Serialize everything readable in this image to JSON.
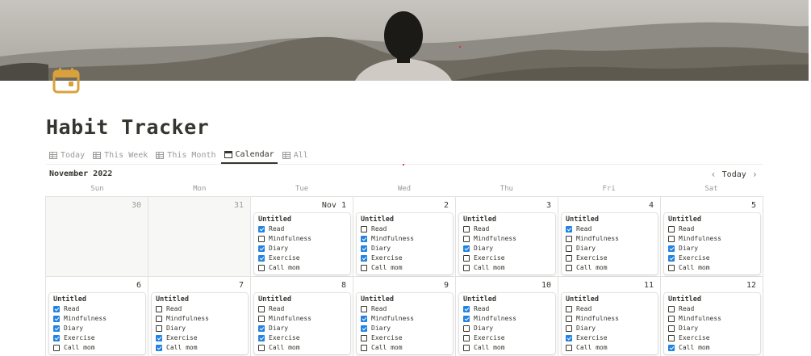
{
  "page": {
    "title": "Habit Tracker",
    "icon": "calendar-icon"
  },
  "tabs": [
    {
      "label": "Today",
      "icon": "table-icon",
      "active": false
    },
    {
      "label": "This Week",
      "icon": "table-icon",
      "active": false
    },
    {
      "label": "This Month",
      "icon": "table-icon",
      "active": false
    },
    {
      "label": "Calendar",
      "icon": "calendar-icon",
      "active": true
    },
    {
      "label": "All",
      "icon": "table-icon",
      "active": false
    }
  ],
  "calendar": {
    "month": "November 2022",
    "today_label": "Today",
    "weekdays": [
      "Sun",
      "Mon",
      "Tue",
      "Wed",
      "Thu",
      "Fri",
      "Sat"
    ],
    "days": [
      {
        "label": "30",
        "outside": true,
        "card": null
      },
      {
        "label": "31",
        "outside": true,
        "card": null
      },
      {
        "label": "Nov 1",
        "outside": false,
        "card": {
          "title": "Untitled",
          "checks": [
            true,
            false,
            true,
            true,
            false
          ]
        }
      },
      {
        "label": "2",
        "outside": false,
        "card": {
          "title": "Untitled",
          "checks": [
            false,
            true,
            true,
            true,
            false
          ]
        }
      },
      {
        "label": "3",
        "outside": false,
        "card": {
          "title": "Untitled",
          "checks": [
            false,
            false,
            true,
            false,
            false
          ]
        }
      },
      {
        "label": "4",
        "outside": false,
        "card": {
          "title": "Untitled",
          "checks": [
            true,
            false,
            false,
            false,
            false
          ]
        }
      },
      {
        "label": "5",
        "outside": false,
        "card": {
          "title": "Untitled",
          "checks": [
            false,
            false,
            true,
            true,
            false
          ]
        }
      },
      {
        "label": "6",
        "outside": false,
        "card": {
          "title": "Untitled",
          "checks": [
            true,
            true,
            true,
            true,
            false
          ]
        }
      },
      {
        "label": "7",
        "outside": false,
        "card": {
          "title": "Untitled",
          "checks": [
            false,
            false,
            false,
            true,
            true
          ]
        }
      },
      {
        "label": "8",
        "outside": false,
        "card": {
          "title": "Untitled",
          "checks": [
            false,
            false,
            true,
            true,
            false
          ]
        }
      },
      {
        "label": "9",
        "outside": false,
        "card": {
          "title": "Untitled",
          "checks": [
            false,
            true,
            true,
            false,
            false
          ]
        }
      },
      {
        "label": "10",
        "outside": false,
        "card": {
          "title": "Untitled",
          "checks": [
            true,
            true,
            false,
            false,
            false
          ]
        }
      },
      {
        "label": "11",
        "outside": false,
        "card": {
          "title": "Untitled",
          "checks": [
            false,
            false,
            false,
            true,
            false
          ]
        }
      },
      {
        "label": "12",
        "outside": false,
        "card": {
          "title": "Untitled",
          "checks": [
            false,
            false,
            false,
            false,
            true
          ]
        }
      }
    ]
  },
  "habits": [
    "Read",
    "Mindfulness",
    "Diary",
    "Exercise",
    "Call mom"
  ],
  "colors": {
    "accent": "#2383e2",
    "icon": "#d9a13b",
    "text": "#37352f",
    "muted": "#9b9a97"
  }
}
